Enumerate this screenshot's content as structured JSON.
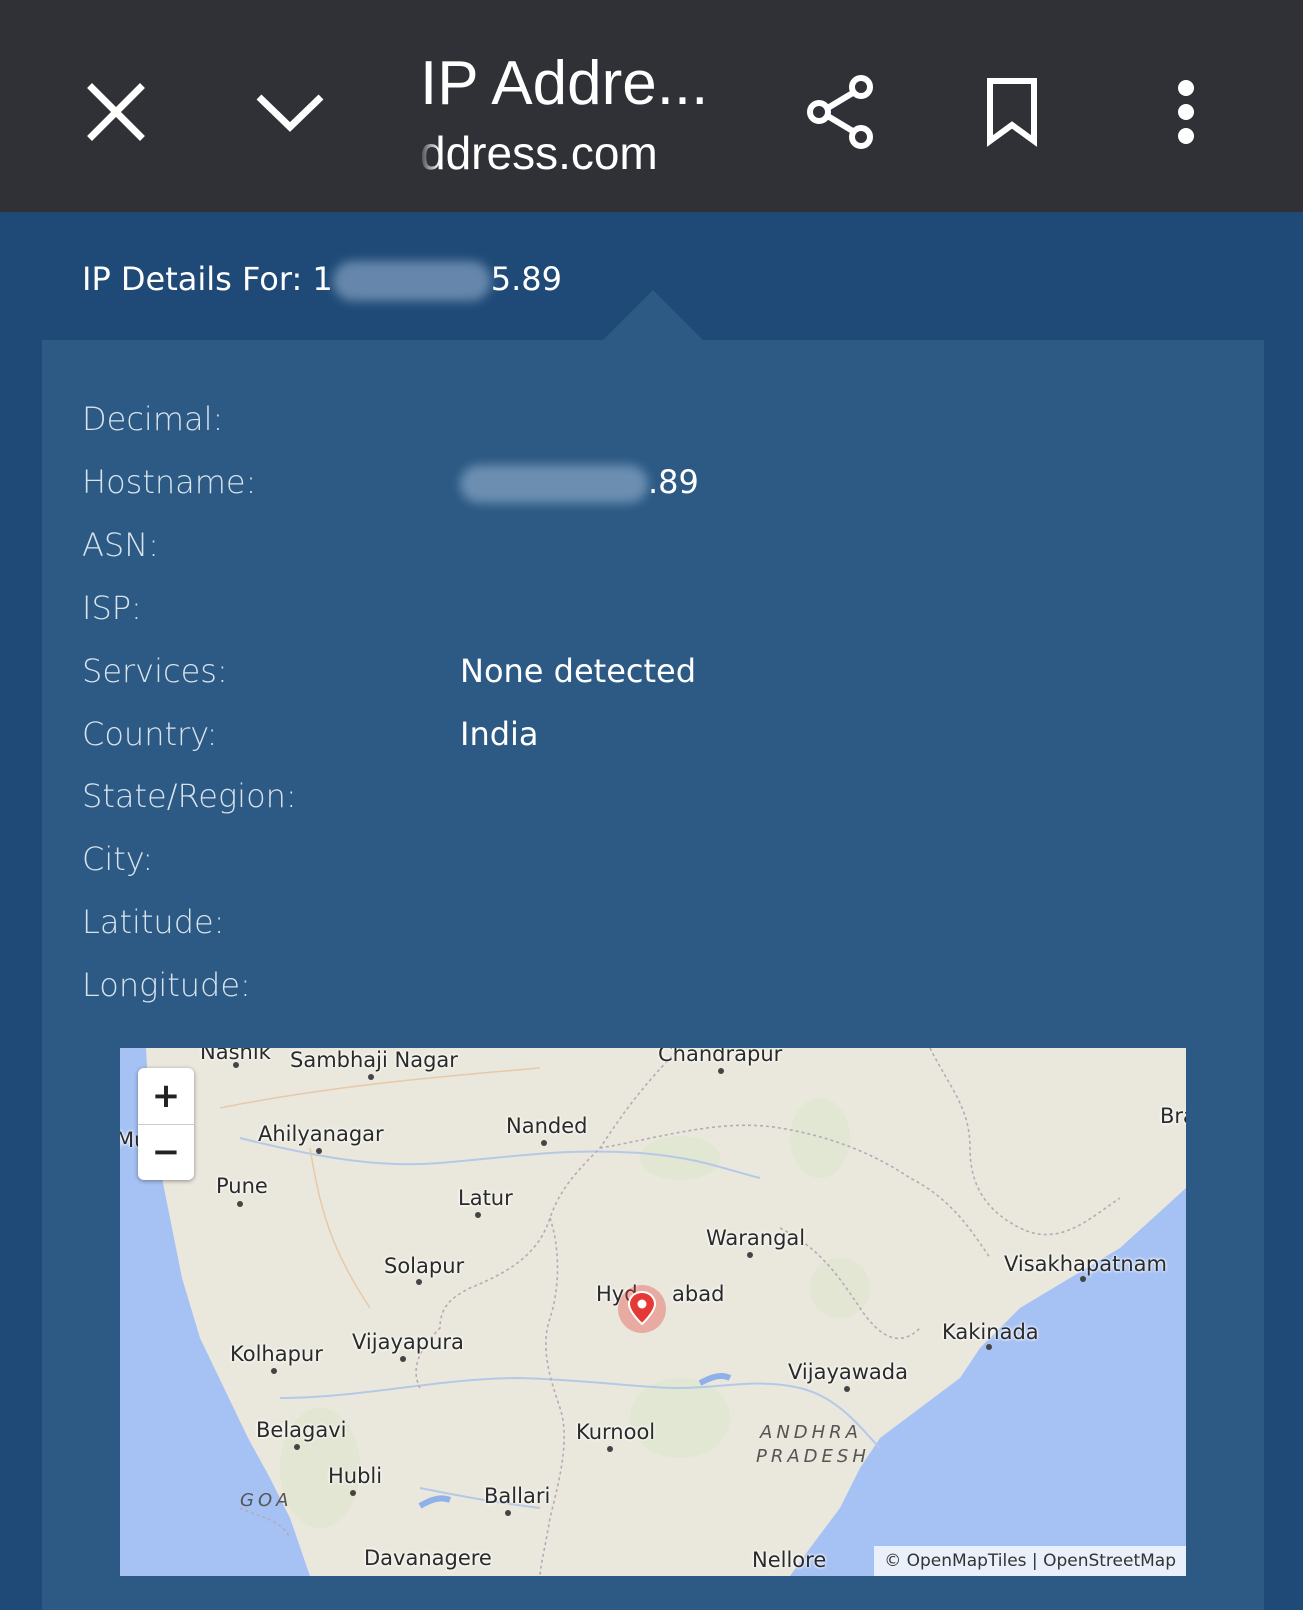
{
  "toolbar": {
    "title": "IP Addre...",
    "url": "ddress.com",
    "icons": [
      "close-icon",
      "chevron-down-icon",
      "share-icon",
      "bookmark-icon",
      "more-vert-icon"
    ]
  },
  "heading": {
    "prefix": "IP Details For: 1",
    "suffix": "5.89"
  },
  "details": {
    "decimal": {
      "label": "Decimal:",
      "value": ""
    },
    "hostname": {
      "label": "Hostname:",
      "value": ".89"
    },
    "asn": {
      "label": "ASN:",
      "value": ""
    },
    "isp": {
      "label": "ISP:",
      "value": ""
    },
    "services": {
      "label": "Services:",
      "value": "None detected"
    },
    "country": {
      "label": "Country:",
      "value": "India"
    },
    "state": {
      "label": "State/Region:",
      "value": ""
    },
    "city": {
      "label": "City:",
      "value": ""
    },
    "latitude": {
      "label": "Latitude:",
      "value": ""
    },
    "longitude": {
      "label": "Longitude:",
      "value": ""
    }
  },
  "map": {
    "zoom_in": "+",
    "zoom_out": "−",
    "attribution": "© OpenMapTiles | OpenStreetMap",
    "cities": {
      "nashik": "Nashik",
      "sambhaji": "Sambhaji Nagar",
      "chandrapur": "Chandrapur",
      "bra": "Bra",
      "mu": "Mu",
      "ahilyanagar": "Ahilyanagar",
      "nanded": "Nanded",
      "pune": "Pune",
      "latur": "Latur",
      "warangal": "Warangal",
      "solapur": "Solapur",
      "visakhapatnam": "Visakhapatnam",
      "hyderabad_a": "Hyd",
      "hyderabad_b": "abad",
      "kakinada": "Kakinada",
      "kolhapur": "Kolhapur",
      "vijayapura": "Vijayapura",
      "vijayawada": "Vijayawada",
      "belagavi": "Belagavi",
      "kurnool": "Kurnool",
      "hubli": "Hubli",
      "ballari": "Ballari",
      "davanagere": "Davanagere",
      "nellore": "Nellore"
    },
    "regions": {
      "andhra": "ANDHRA",
      "pradesh": "PRADESH",
      "goa": "GOA"
    },
    "colors": {
      "land": "#eae8dd",
      "water": "#a6c1f3",
      "marker": "#e53935"
    }
  }
}
